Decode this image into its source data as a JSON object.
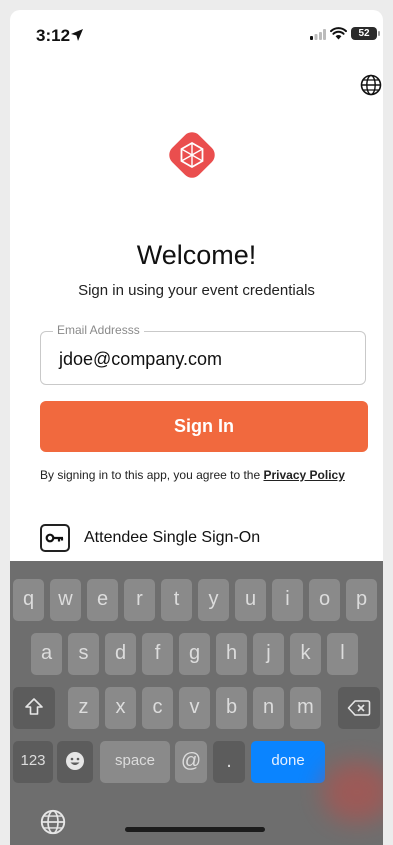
{
  "status": {
    "time": "3:12",
    "battery": "52"
  },
  "welcome": {
    "title": "Welcome!",
    "subtitle": "Sign in using your event credentials"
  },
  "form": {
    "email_label": "Email Addresss",
    "email_value": "jdoe@company.com",
    "sign_in_label": "Sign In",
    "agree_text": "By signing in to this app, you agree to the ",
    "privacy_link": "Privacy Policy",
    "sso_label": "Attendee Single Sign-On"
  },
  "colors": {
    "brand": "#f1693e",
    "logo": "#ea4e4e",
    "done_key": "#0a84ff"
  },
  "icons": [
    "location-arrow-icon",
    "signal-icon",
    "wifi-icon",
    "battery-icon",
    "globe-icon",
    "app-logo-icon",
    "key-icon",
    "shift-icon",
    "delete-icon",
    "emoji-icon"
  ],
  "keyboard": {
    "row1": [
      "q",
      "w",
      "e",
      "r",
      "t",
      "y",
      "u",
      "i",
      "o",
      "p"
    ],
    "row2": [
      "a",
      "s",
      "d",
      "f",
      "g",
      "h",
      "j",
      "k",
      "l"
    ],
    "row3": [
      "z",
      "x",
      "c",
      "v",
      "b",
      "n",
      "m"
    ],
    "numbers_label": "123",
    "space_label": "space",
    "at_label": "@",
    "dot_label": ".",
    "done_label": "done"
  }
}
